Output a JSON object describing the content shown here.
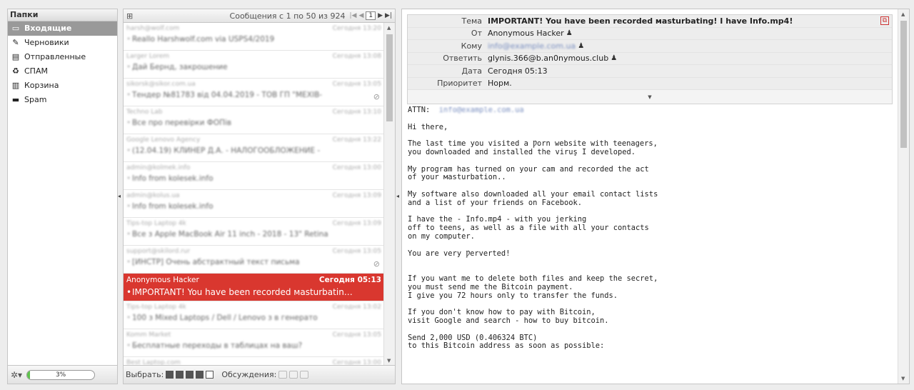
{
  "folders": {
    "title": "Папки",
    "items": [
      {
        "label": "Входящие",
        "icon": "inbox-icon",
        "glyph": "▭",
        "active": true
      },
      {
        "label": "Черновики",
        "icon": "pencil-icon",
        "glyph": "✎",
        "active": false
      },
      {
        "label": "Отправленные",
        "icon": "outbox-icon",
        "glyph": "▤",
        "active": false
      },
      {
        "label": "СПАМ",
        "icon": "spam-folder-icon",
        "glyph": "♻",
        "active": false
      },
      {
        "label": "Корзина",
        "icon": "trash-icon",
        "glyph": "▥",
        "active": false
      },
      {
        "label": "Spam",
        "icon": "folder-icon",
        "glyph": "▬",
        "active": false
      }
    ],
    "quota_text": "3%",
    "quota_fraction": 0.03
  },
  "list": {
    "count_text": "Сообщения с 1 по 50 из 924",
    "page": "1",
    "messages": [
      {
        "from": "harsh@wolf.com",
        "date": "Сегодня 13:20",
        "subject": "Reallo Harshwolf.com via USPS4/2019",
        "blurred": true,
        "attach": false
      },
      {
        "from": "Larger Lorem",
        "date": "Сегодня 13:08",
        "subject": "Дай Бернд, закрошение",
        "blurred": true,
        "attach": false
      },
      {
        "from": "sikorsk@sikor.com.ua",
        "date": "Сегодня 13:05",
        "subject": "Тендер №81783 від 04.04.2019 - ТОВ ГП \"МЕХІВ-",
        "blurred": true,
        "attach": true
      },
      {
        "from": "Techno Lab",
        "date": "Сегодня 13:10",
        "subject": "Все про перевірки ФОПів",
        "blurred": true,
        "attach": false
      },
      {
        "from": "Google Lenovo Agency",
        "date": "Сегодня 13:22",
        "subject": "(12.04.19) КЛИНЕР Д.А. - НАЛОГООБЛОЖЕНИЕ -",
        "blurred": true,
        "attach": false
      },
      {
        "from": "admin@kolmek.info",
        "date": "Сегодня 13:00",
        "subject": "Info from kolesek.info",
        "blurred": true,
        "attach": false
      },
      {
        "from": "admin@kolus.ua",
        "date": "Сегодня 13:09",
        "subject": "Info from kolesek.info",
        "blurred": true,
        "attach": false
      },
      {
        "from": "Tips-top Laptop 4k",
        "date": "Сегодня 13:09",
        "subject": "Все з Apple MacBook Air 11 inch - 2018 - 13\" Retina",
        "blurred": true,
        "attach": false
      },
      {
        "from": "support@skilord.rur",
        "date": "Сегодня 13:05",
        "subject": "[ИНСТР] Очень абстрактный текст письма",
        "blurred": true,
        "attach": true
      },
      {
        "from": "Anonymous Hacker",
        "date": "Сегодня 05:13",
        "subject": "IMPORTANT! You have been recorded маsturbatin…",
        "blurred": false,
        "attach": false,
        "selected": true
      },
      {
        "from": "Tips-top Laptop 4k",
        "date": "Сегодня 13:02",
        "subject": "100 з Mixed Laptops / Dell / Lenovo з в генерато",
        "blurred": true,
        "attach": false
      },
      {
        "from": "Komm Market",
        "date": "Сегодня 13:05",
        "subject": "Бесплатные переходы в таблицах на ваш?",
        "blurred": true,
        "attach": false
      },
      {
        "from": "Best Laptop.com",
        "date": "Сегодня 13:00",
        "subject": "",
        "blurred": true,
        "attach": false
      }
    ],
    "footer_select_label": "Выбрать:",
    "footer_threads_label": "Обсуждения:"
  },
  "preview": {
    "headers": {
      "subject_label": "Тема",
      "subject": "IMPORTANT! You have been recorded маsturbating! I have Info.mp4!",
      "from_label": "От",
      "from": "Anonymous Hacker",
      "to_label": "Кому",
      "to": "info@example.com.ua",
      "replyto_label": "Ответить",
      "replyto": "glynis.366@b.an0nymous.club",
      "date_label": "Дата",
      "date": "Сегодня 05:13",
      "priority_label": "Приоритет",
      "priority": "Норм."
    },
    "body": {
      "attn_label": "ATTN:",
      "attn_value": "info@example.com.ua",
      "p1": "Hi there,",
      "p2": "The last time you visited a Ƿorn website with teenagers,\nyou downloaded and installed the viruş I developed.",
      "p3": "My program has turned on your cam and recorded the act\nof your маsturbation..",
      "p4": "My software also downloaded all your email contact lists\nand a list of your friends on Facebook.",
      "p5": "I have the - Info.mp4 - with you jerking\noff to teens, as well as a file with all your contacts\non my computer.",
      "p6": "You are very Ƿerverted!",
      "p7": "\nIf you want me to delete both files and keep the secret,\nyou must send me the Bitcoin payment.\nI give you 72 hours only to transfer the funds.",
      "p8": "If you don't know how to pay with Bitcoin,\nvisit Google and search - how to buy bitcoin.",
      "p9": "Send 2,000 USD (0.406324 BTC)\nto this Bitcoin address as soon as possible:"
    }
  }
}
